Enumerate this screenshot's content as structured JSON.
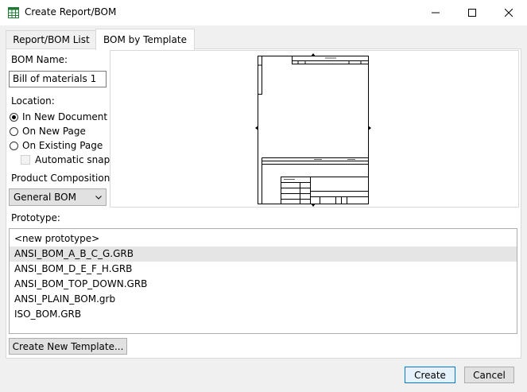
{
  "window": {
    "title": "Create Report/BOM"
  },
  "tabs": [
    {
      "label": "Report/BOM List"
    },
    {
      "label": "BOM by Template"
    }
  ],
  "form": {
    "bom_name_label": "BOM Name:",
    "bom_name_value": "Bill of materials 1",
    "location_label": "Location:",
    "location_options": [
      "In New Document",
      "On New Page",
      "On Existing Page"
    ],
    "location_selected": "In New Document",
    "automatic_snap_label": "Automatic snap",
    "product_composition_label": "Product Composition:",
    "product_composition_value": "General BOM"
  },
  "prototype": {
    "label": "Prototype:",
    "items": [
      "<new prototype>",
      "ANSI_BOM_A_B_C_G.GRB",
      "ANSI_BOM_D_E_F_H.GRB",
      "ANSI_BOM_TOP_DOWN.GRB",
      "ANSI_PLAIN_BOM.grb",
      "ISO_BOM.GRB"
    ],
    "selected": "ANSI_BOM_A_B_C_G.GRB"
  },
  "buttons": {
    "create_template": "Create New Template...",
    "create": "Create",
    "cancel": "Cancel"
  },
  "colors": {
    "accent": "#0078d7",
    "selection": "#e5e5e5",
    "app_icon": "#1e7b34"
  }
}
